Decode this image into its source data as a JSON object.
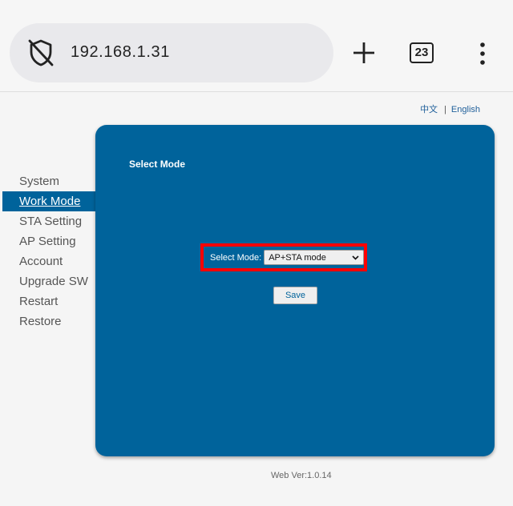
{
  "browser": {
    "url": "192.168.1.31",
    "tab_count": "23"
  },
  "languages": [
    {
      "label": "中文"
    },
    {
      "label": "English"
    }
  ],
  "lang_separator": "|",
  "sidebar": {
    "items": [
      {
        "label": "System"
      },
      {
        "label": "Work Mode",
        "active": true
      },
      {
        "label": "STA Setting"
      },
      {
        "label": "AP Setting"
      },
      {
        "label": "Account"
      },
      {
        "label": "Upgrade SW"
      },
      {
        "label": "Restart"
      },
      {
        "label": "Restore"
      }
    ]
  },
  "panel": {
    "title": "Select Mode",
    "mode_label": "Select Mode:",
    "mode_selected": "AP+STA mode",
    "save_label": "Save"
  },
  "footer": {
    "version": "Web Ver:1.0.14"
  },
  "colors": {
    "accent": "#00639b",
    "highlight_border": "#ff0000"
  },
  "icons": {
    "site_security": "shield-off-icon",
    "new_tab": "plus-icon",
    "menu": "more-vert-icon",
    "select_arrow": "chevron-down-icon"
  }
}
